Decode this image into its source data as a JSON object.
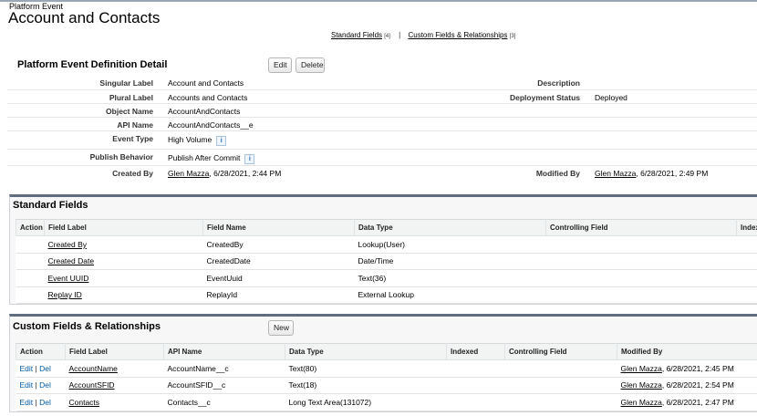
{
  "header": {
    "subtitle": "Platform Event",
    "title": "Account and Contacts"
  },
  "quicklinks": {
    "standard": "Standard Fields",
    "standard_count": "[4]",
    "separator": "|",
    "custom": "Custom Fields & Relationships",
    "custom_count": "[3]"
  },
  "detail": {
    "heading": "Platform Event Definition Detail",
    "edit_label": "Edit",
    "delete_label": "Delete",
    "singular_label": {
      "label": "Singular Label",
      "value": "Account and Contacts"
    },
    "description": {
      "label": "Description",
      "value": ""
    },
    "plural_label": {
      "label": "Plural Label",
      "value": "Accounts and Contacts"
    },
    "deployment_status": {
      "label": "Deployment Status",
      "value": "Deployed"
    },
    "object_name": {
      "label": "Object Name",
      "value": "AccountAndContacts"
    },
    "api_name": {
      "label": "API Name",
      "value": "AccountAndContacts__e"
    },
    "event_type": {
      "label": "Event Type",
      "value": "High Volume"
    },
    "publish_behavior": {
      "label": "Publish Behavior",
      "value": "Publish After Commit"
    },
    "created_by": {
      "label": "Created By",
      "user": "Glen Mazza",
      "date": ", 6/28/2021, 2:44 PM"
    },
    "modified_by": {
      "label": "Modified By",
      "user": "Glen Mazza",
      "date": ", 6/28/2021, 2:49 PM"
    },
    "info_icon": "i"
  },
  "standard_fields": {
    "title": "Standard Fields",
    "columns": [
      "Action",
      "Field Label",
      "Field Name",
      "Data Type",
      "Controlling Field",
      "Index"
    ],
    "rows": [
      {
        "label": "Created By",
        "name": "CreatedBy",
        "type": "Lookup(User)"
      },
      {
        "label": "Created Date",
        "name": "CreatedDate",
        "type": "Date/Time"
      },
      {
        "label": "Event UUID",
        "name": "EventUuid",
        "type": "Text(36)"
      },
      {
        "label": "Replay ID",
        "name": "ReplayId",
        "type": "External Lookup"
      }
    ]
  },
  "custom_fields": {
    "title": "Custom Fields & Relationships",
    "new_label": "New",
    "columns": [
      "Action",
      "Field Label",
      "API Name",
      "Data Type",
      "Indexed",
      "Controlling Field",
      "Modified By"
    ],
    "edit_label": "Edit",
    "pipe": "|",
    "del_label": "Del",
    "rows": [
      {
        "label": "AccountName",
        "api": "AccountName__c",
        "type": "Text(80)",
        "modified_user": "Glen Mazza",
        "modified_date": ", 6/28/2021, 2:45 PM"
      },
      {
        "label": "AccountSFID",
        "api": "AccountSFID__c",
        "type": "Text(18)",
        "modified_user": "Glen Mazza",
        "modified_date": ", 6/28/2021, 2:54 PM"
      },
      {
        "label": "Contacts",
        "api": "Contacts__c",
        "type": "Long Text Area(131072)",
        "modified_user": "Glen Mazza",
        "modified_date": ", 6/28/2021, 2:47 PM"
      }
    ]
  },
  "colors": {
    "section_border": "#5f6d7e",
    "action_link": "#015ba7",
    "info_icon": "#2a6bb5"
  }
}
